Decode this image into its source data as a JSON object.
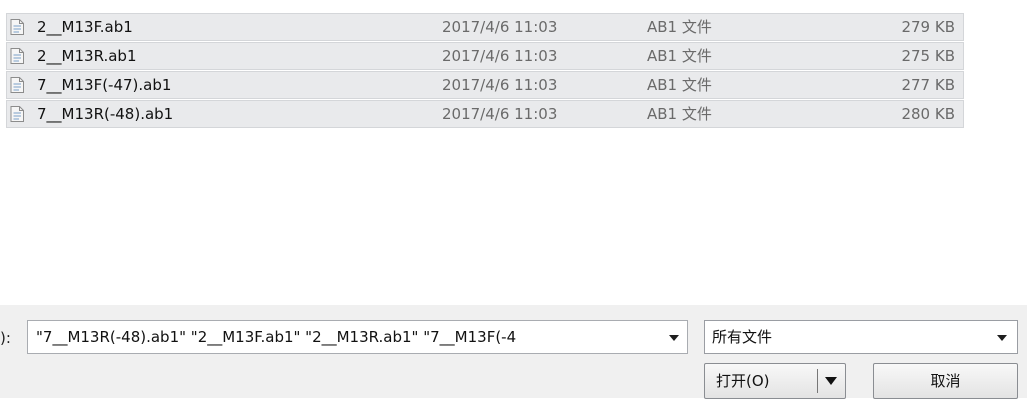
{
  "files": [
    {
      "name": "2__M13F.ab1",
      "date": "2017/4/6 11:03",
      "type": "AB1 文件",
      "size": "279 KB",
      "icon": "file-icon"
    },
    {
      "name": "2__M13R.ab1",
      "date": "2017/4/6 11:03",
      "type": "AB1 文件",
      "size": "275 KB",
      "icon": "file-icon"
    },
    {
      "name": "7__M13F(-47).ab1",
      "date": "2017/4/6 11:03",
      "type": "AB1 文件",
      "size": "277 KB",
      "icon": "file-icon"
    },
    {
      "name": "7__M13R(-48).ab1",
      "date": "2017/4/6 11:03",
      "type": "AB1 文件",
      "size": "280 KB",
      "icon": "file-icon"
    }
  ],
  "bottom": {
    "filename_label": "):",
    "filename_value": "\"7__M13R(-48).ab1\" \"2__M13F.ab1\" \"2__M13R.ab1\" \"7__M13F(-4",
    "filetype_value": "所有文件",
    "open_label": "打开(O)",
    "cancel_label": "取消"
  },
  "colors": {
    "row_selected": "#e9eaec",
    "bottom_bg": "#f0f0f0"
  }
}
